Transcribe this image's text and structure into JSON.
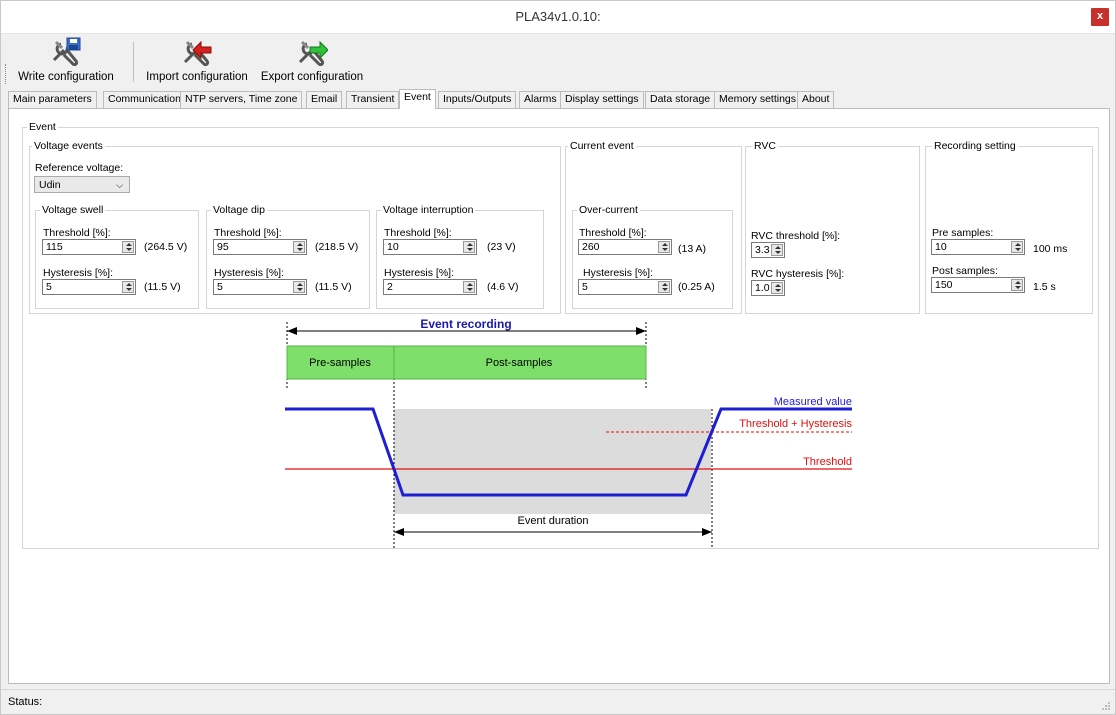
{
  "window": {
    "title": "PLA34v1.0.10:",
    "close": "x"
  },
  "toolbar": {
    "write": "Write configuration",
    "import": "Import configuration",
    "export": "Export configuration"
  },
  "tabs": [
    "Main parameters",
    "Communication",
    "NTP servers, Time zone",
    "Email",
    "Transient",
    "Event",
    "Inputs/Outputs",
    "Alarms",
    "Display settings",
    "Data storage",
    "Memory settings",
    "About"
  ],
  "active_tab": "Event",
  "event": {
    "group_title": "Event",
    "voltage_events": {
      "title": "Voltage events",
      "reference_label": "Reference voltage:",
      "reference_value": "Udin",
      "swell": {
        "title": "Voltage swell",
        "threshold_label": "Threshold [%]:",
        "threshold": "115",
        "threshold_unit": "(264.5 V)",
        "hysteresis_label": "Hysteresis [%]:",
        "hysteresis": "5",
        "hysteresis_unit": "(11.5 V)"
      },
      "dip": {
        "title": "Voltage dip",
        "threshold_label": "Threshold [%]:",
        "threshold": "95",
        "threshold_unit": "(218.5 V)",
        "hysteresis_label": "Hysteresis [%]:",
        "hysteresis": "5",
        "hysteresis_unit": "(11.5 V)"
      },
      "interruption": {
        "title": "Voltage interruption",
        "threshold_label": "Threshold [%]:",
        "threshold": "10",
        "threshold_unit": "(23 V)",
        "hysteresis_label": "Hysteresis [%]:",
        "hysteresis": "2",
        "hysteresis_unit": "(4.6 V)"
      }
    },
    "current_event": {
      "title": "Current event",
      "over_current": {
        "title": "Over-current",
        "threshold_label": "Threshold [%]:",
        "threshold": "260",
        "threshold_unit": "(13 A)",
        "hysteresis_label": "Hysteresis [%]:",
        "hysteresis": "5",
        "hysteresis_unit": "(0.25 A)"
      }
    },
    "rvc": {
      "title": "RVC",
      "threshold_label": "RVC threshold [%]:",
      "threshold": "3.3",
      "hysteresis_label": "RVC hysteresis [%]:",
      "hysteresis": "1.0"
    },
    "recording": {
      "title": "Recording setting",
      "pre_label": "Pre samples:",
      "pre": "10",
      "pre_unit": "100 ms",
      "post_label": "Post samples:",
      "post": "150",
      "post_unit": "1.5 s"
    }
  },
  "diagram": {
    "event_recording": "Event recording",
    "pre_samples": "Pre-samples",
    "post_samples": "Post-samples",
    "measured_value": "Measured value",
    "threshold_hysteresis": "Threshold + Hysteresis",
    "threshold": "Threshold",
    "event_duration": "Event duration",
    "colors": {
      "measured": "#1e1ed2",
      "threshold": "#e01010",
      "band": "#7ee06a",
      "shade": "#dcdcdc",
      "title": "#1a1aaa"
    }
  },
  "status": {
    "label": "Status:"
  }
}
